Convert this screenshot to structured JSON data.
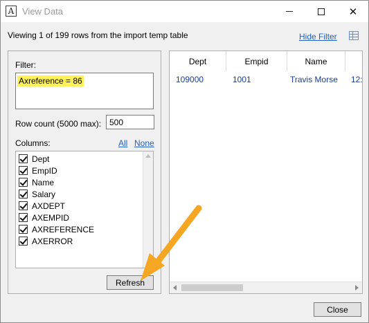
{
  "window": {
    "title": "View Data",
    "app_icon_letter": "A"
  },
  "header": {
    "summary": "Viewing 1 of 199 rows from the import temp table",
    "hide_filter_label": "Hide Filter",
    "grid_icon": "grid-view-icon"
  },
  "filter": {
    "label": "Filter:",
    "value": "Axreference = 86",
    "highlight_color": "#fff15a"
  },
  "rowcount": {
    "label": "Row count (5000 max):",
    "value": "500"
  },
  "columns": {
    "label": "Columns:",
    "all_label": "All",
    "none_label": "None",
    "items": [
      {
        "label": "Dept",
        "checked": true
      },
      {
        "label": "EmpID",
        "checked": true
      },
      {
        "label": "Name",
        "checked": true
      },
      {
        "label": "Salary",
        "checked": true
      },
      {
        "label": "AXDEPT",
        "checked": true
      },
      {
        "label": "AXEMPID",
        "checked": true
      },
      {
        "label": "AXREFERENCE",
        "checked": true
      },
      {
        "label": "AXERROR",
        "checked": true
      }
    ]
  },
  "buttons": {
    "refresh": "Refresh",
    "close": "Close"
  },
  "grid": {
    "headers": [
      "Dept",
      "Empid",
      "Name",
      ""
    ],
    "rows": [
      [
        "109000",
        "1001",
        "Travis Morse",
        "12:"
      ]
    ]
  },
  "colors": {
    "link": "#1f5fbf",
    "annotation_arrow": "#f5a623",
    "cell_text": "#1a3d8f"
  }
}
